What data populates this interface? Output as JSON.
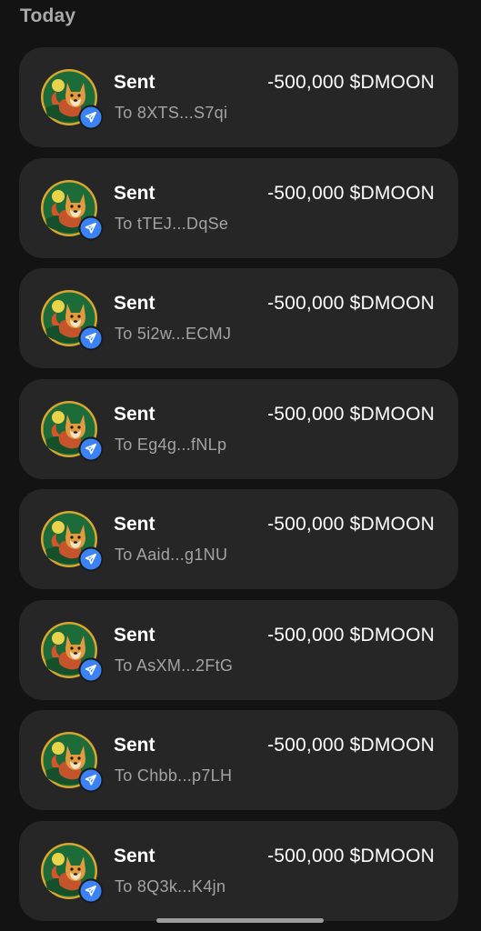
{
  "section": {
    "title": "Today"
  },
  "colors": {
    "background": "#131313",
    "card": "#262626",
    "badge": "#3b82f6",
    "avatar_ring": "#e0b23a",
    "avatar_bg": "#1e6b3a"
  },
  "transactions": [
    {
      "title": "Sent",
      "amount": "-500,000 $DMOON",
      "recipient": "To 8XTS...S7qi",
      "icon": "dmoon-token-avatar",
      "badge_icon": "send-arrow-icon"
    },
    {
      "title": "Sent",
      "amount": "-500,000 $DMOON",
      "recipient": "To tTEJ...DqSe",
      "icon": "dmoon-token-avatar",
      "badge_icon": "send-arrow-icon"
    },
    {
      "title": "Sent",
      "amount": "-500,000 $DMOON",
      "recipient": "To 5i2w...ECMJ",
      "icon": "dmoon-token-avatar",
      "badge_icon": "send-arrow-icon"
    },
    {
      "title": "Sent",
      "amount": "-500,000 $DMOON",
      "recipient": "To Eg4g...fNLp",
      "icon": "dmoon-token-avatar",
      "badge_icon": "send-arrow-icon"
    },
    {
      "title": "Sent",
      "amount": "-500,000 $DMOON",
      "recipient": "To Aaid...g1NU",
      "icon": "dmoon-token-avatar",
      "badge_icon": "send-arrow-icon"
    },
    {
      "title": "Sent",
      "amount": "-500,000 $DMOON",
      "recipient": "To AsXM...2FtG",
      "icon": "dmoon-token-avatar",
      "badge_icon": "send-arrow-icon"
    },
    {
      "title": "Sent",
      "amount": "-500,000 $DMOON",
      "recipient": "To Chbb...p7LH",
      "icon": "dmoon-token-avatar",
      "badge_icon": "send-arrow-icon"
    },
    {
      "title": "Sent",
      "amount": "-500,000 $DMOON",
      "recipient": "To 8Q3k...K4jn",
      "icon": "dmoon-token-avatar",
      "badge_icon": "send-arrow-icon"
    }
  ]
}
